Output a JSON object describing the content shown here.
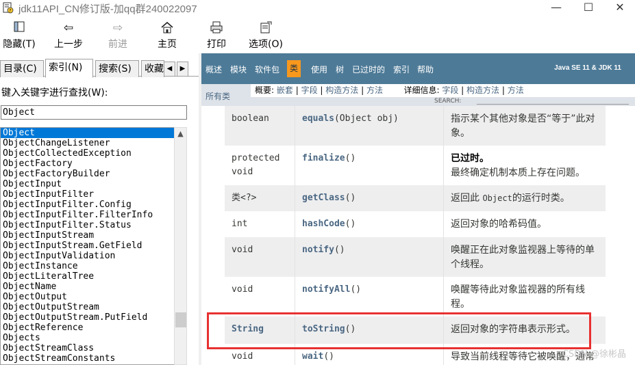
{
  "window": {
    "title": "jdk11API_CN修订版-加qq群240022097",
    "minimize_glyph": "—",
    "maximize_glyph": "☐",
    "close_glyph": "✕"
  },
  "toolbar": {
    "hide_label": "隐藏(T)",
    "back_label": "上一步",
    "forward_label": "前进",
    "home_label": "主页",
    "print_label": "打印",
    "options_label": "选项(O)",
    "icons": {
      "hide": "hide-pane-icon",
      "back": "arrow-left-icon",
      "forward": "arrow-right-icon",
      "home": "home-icon",
      "print": "printer-icon",
      "options": "options-icon"
    }
  },
  "left": {
    "tabs": [
      "目录(C)",
      "索引(N)",
      "搜索(S)",
      "收藏"
    ],
    "active_tab": "索引(N)",
    "find_label": "键入关键字进行查找(W):",
    "find_value": "Object",
    "list": [
      "Object",
      "ObjectChangeListener",
      "ObjectCollectedException",
      "ObjectFactory",
      "ObjectFactoryBuilder",
      "ObjectInput",
      "ObjectInputFilter",
      "ObjectInputFilter.Config",
      "ObjectInputFilter.FilterInfo",
      "ObjectInputFilter.Status",
      "ObjectInputStream",
      "ObjectInputStream.GetField",
      "ObjectInputValidation",
      "ObjectInstance",
      "ObjectLiteralTree",
      "ObjectName",
      "ObjectOutput",
      "ObjectOutputStream",
      "ObjectOutputStream.PutField",
      "ObjectReference",
      "Objects",
      "ObjectStreamClass",
      "ObjectStreamConstants"
    ],
    "selected": "Object"
  },
  "nav": {
    "items": [
      "概述",
      "模块",
      "软件包",
      "类",
      "使用",
      "树",
      "已过时的",
      "索引",
      "帮助"
    ],
    "active": "类",
    "version": "Java SE 11 & JDK 11",
    "all_classes": "所有类",
    "summary_label": "概要:",
    "summary_links": [
      "嵌套",
      "字段",
      "构造方法",
      "方法"
    ],
    "detail_label": "详细信息:",
    "detail_links": [
      "字段",
      "构造方法",
      "方法"
    ],
    "search_label": "SEARCH:"
  },
  "methods": [
    {
      "modifier": "boolean",
      "name": "equals",
      "params": "(Object obj)",
      "desc": "指示某个其他对象是否“等于”此对象。"
    },
    {
      "modifier": "protected void",
      "name": "finalize",
      "params": "()",
      "desc_bold": "已过时。",
      "desc": "最终确定机制本质上存在问题。"
    },
    {
      "modifier": "类<?>",
      "name": "getClass",
      "params": "()",
      "desc_pre": "返回此 ",
      "desc_code": "Object",
      "desc": "的运行时类。"
    },
    {
      "modifier": "int",
      "name": "hashCode",
      "params": "()",
      "desc": "返回对象的哈希码值。"
    },
    {
      "modifier": "void",
      "name": "notify",
      "params": "()",
      "desc": "唤醒正在此对象监视器上等待的单个线程。"
    },
    {
      "modifier": "void",
      "name": "notifyAll",
      "params": "()",
      "desc": "唤醒等待此对象监视器的所有线程。"
    },
    {
      "modifier": "String",
      "name": "toString",
      "params": "()",
      "desc": "返回对象的字符串表示形式。"
    },
    {
      "modifier": "void",
      "name": "wait",
      "params": "()",
      "desc": "导致当前线程等待它被唤醒，通常"
    }
  ],
  "watermark": "CSDN @徐彬晶",
  "colors": {
    "navbar": "#4d7a97",
    "nav_active": "#f8981d",
    "subnav": "#dee3e9",
    "link": "#4a6782",
    "highlight_box": "#e83030",
    "selection": "#0078d7"
  }
}
